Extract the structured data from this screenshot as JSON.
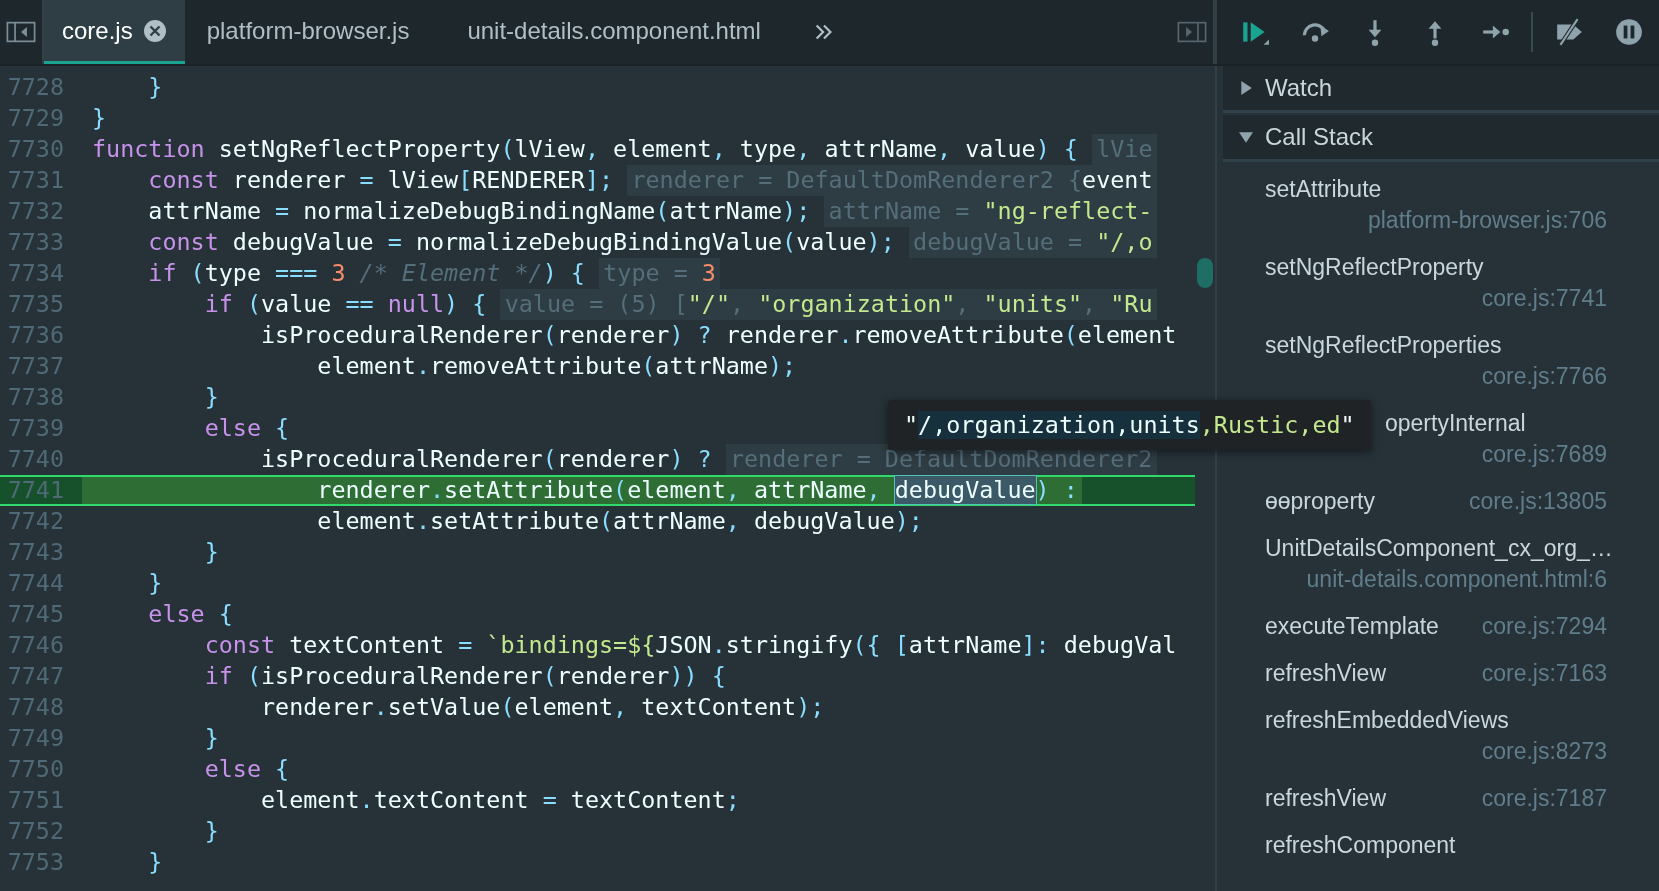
{
  "editor_tabs": [
    {
      "label": "core.js",
      "selected": true,
      "closable": true
    },
    {
      "label": "platform-browser.js",
      "selected": false,
      "closable": false
    },
    {
      "label": "unit-details.component.html",
      "selected": false,
      "closable": false
    }
  ],
  "debug_toolbar": [
    {
      "kind": "resume"
    },
    {
      "kind": "step_over"
    },
    {
      "kind": "step_into"
    },
    {
      "kind": "step_out"
    },
    {
      "kind": "step"
    },
    {
      "kind": "divider"
    },
    {
      "kind": "deactivate_breakpoints"
    },
    {
      "kind": "pause_exceptions"
    }
  ],
  "code": {
    "lines": [
      {
        "number": "7728",
        "current": false,
        "tokens": [
          {
            "kind": "punct",
            "text": "    }"
          }
        ]
      },
      {
        "number": "7729",
        "current": false,
        "tokens": [
          {
            "kind": "punct",
            "text": "}"
          }
        ]
      },
      {
        "number": "7730",
        "current": false,
        "tokens": [
          {
            "kind": "keyword",
            "text": "function"
          },
          {
            "kind": "plain",
            "text": " setNgReflectProperty"
          },
          {
            "kind": "punct",
            "text": "("
          },
          {
            "kind": "plain",
            "text": "lView"
          },
          {
            "kind": "punct",
            "text": ","
          },
          {
            "kind": "plain",
            "text": " element"
          },
          {
            "kind": "punct",
            "text": ","
          },
          {
            "kind": "plain",
            "text": " type"
          },
          {
            "kind": "punct",
            "text": ","
          },
          {
            "kind": "plain",
            "text": " attrName"
          },
          {
            "kind": "punct",
            "text": ","
          },
          {
            "kind": "plain",
            "text": " value"
          },
          {
            "kind": "punct",
            "text": ") {"
          }
        ],
        "hint": [
          {
            "kind": "muted",
            "text": "lVie"
          }
        ]
      },
      {
        "number": "7731",
        "current": false,
        "tokens": [
          {
            "kind": "keyword",
            "text": "    const"
          },
          {
            "kind": "plain",
            "text": " renderer "
          },
          {
            "kind": "punct",
            "text": "="
          },
          {
            "kind": "plain",
            "text": " lView"
          },
          {
            "kind": "punct",
            "text": "["
          },
          {
            "kind": "plain",
            "text": "RENDERER"
          },
          {
            "kind": "punct",
            "text": "];"
          }
        ],
        "hint": [
          {
            "kind": "muted",
            "text": "renderer = DefaultDomRenderer2 {"
          },
          {
            "kind": "plain",
            "text": "event"
          }
        ]
      },
      {
        "number": "7732",
        "current": false,
        "tokens": [
          {
            "kind": "plain",
            "text": "    attrName "
          },
          {
            "kind": "punct",
            "text": "="
          },
          {
            "kind": "plain",
            "text": " normalizeDebugBindingName"
          },
          {
            "kind": "punct",
            "text": "("
          },
          {
            "kind": "plain",
            "text": "attrName"
          },
          {
            "kind": "punct",
            "text": ");"
          }
        ],
        "hint": [
          {
            "kind": "muted",
            "text": "attrName = "
          },
          {
            "kind": "string",
            "text": "\"ng-reflect-"
          }
        ]
      },
      {
        "number": "7733",
        "current": false,
        "tokens": [
          {
            "kind": "keyword",
            "text": "    const"
          },
          {
            "kind": "plain",
            "text": " debugValue "
          },
          {
            "kind": "punct",
            "text": "="
          },
          {
            "kind": "plain",
            "text": " normalizeDebugBindingValue"
          },
          {
            "kind": "punct",
            "text": "("
          },
          {
            "kind": "plain",
            "text": "value"
          },
          {
            "kind": "punct",
            "text": ");"
          }
        ],
        "hint": [
          {
            "kind": "muted",
            "text": "debugValue = "
          },
          {
            "kind": "string",
            "text": "\"/,o"
          }
        ]
      },
      {
        "number": "7734",
        "current": false,
        "tokens": [
          {
            "kind": "keyword",
            "text": "    if"
          },
          {
            "kind": "punct",
            "text": " ("
          },
          {
            "kind": "plain",
            "text": "type "
          },
          {
            "kind": "punct",
            "text": "==="
          },
          {
            "kind": "number",
            "text": " 3"
          },
          {
            "kind": "comment",
            "text": " /* Element */"
          },
          {
            "kind": "punct",
            "text": ") {"
          }
        ],
        "hint": [
          {
            "kind": "muted",
            "text": "type = "
          },
          {
            "kind": "number",
            "text": "3"
          }
        ]
      },
      {
        "number": "7735",
        "current": false,
        "tokens": [
          {
            "kind": "keyword",
            "text": "        if"
          },
          {
            "kind": "punct",
            "text": " ("
          },
          {
            "kind": "plain",
            "text": "value "
          },
          {
            "kind": "punct",
            "text": "=="
          },
          {
            "kind": "keyword",
            "text": " null"
          },
          {
            "kind": "punct",
            "text": ") {"
          }
        ],
        "hint": [
          {
            "kind": "muted",
            "text": "value = (5) ["
          },
          {
            "kind": "string",
            "text": "\"/\""
          },
          {
            "kind": "muted",
            "text": ", "
          },
          {
            "kind": "string",
            "text": "\"organization\""
          },
          {
            "kind": "muted",
            "text": ", "
          },
          {
            "kind": "string",
            "text": "\"units\""
          },
          {
            "kind": "muted",
            "text": ", "
          },
          {
            "kind": "string",
            "text": "\"Ru"
          }
        ]
      },
      {
        "number": "7736",
        "current": false,
        "tokens": [
          {
            "kind": "plain",
            "text": "            isProceduralRenderer"
          },
          {
            "kind": "punct",
            "text": "("
          },
          {
            "kind": "plain",
            "text": "renderer"
          },
          {
            "kind": "punct",
            "text": ") ?"
          },
          {
            "kind": "plain",
            "text": " renderer"
          },
          {
            "kind": "punct",
            "text": "."
          },
          {
            "kind": "plain",
            "text": "removeAttribute"
          },
          {
            "kind": "punct",
            "text": "("
          },
          {
            "kind": "plain",
            "text": "element"
          }
        ]
      },
      {
        "number": "7737",
        "current": false,
        "tokens": [
          {
            "kind": "plain",
            "text": "                element"
          },
          {
            "kind": "punct",
            "text": "."
          },
          {
            "kind": "plain",
            "text": "removeAttribute"
          },
          {
            "kind": "punct",
            "text": "("
          },
          {
            "kind": "plain",
            "text": "attrName"
          },
          {
            "kind": "punct",
            "text": ");"
          }
        ]
      },
      {
        "number": "7738",
        "current": false,
        "tokens": [
          {
            "kind": "punct",
            "text": "        }"
          }
        ]
      },
      {
        "number": "7739",
        "current": false,
        "tokens": [
          {
            "kind": "keyword",
            "text": "        else"
          },
          {
            "kind": "punct",
            "text": " {"
          }
        ]
      },
      {
        "number": "7740",
        "current": false,
        "tokens": [
          {
            "kind": "plain",
            "text": "            isProceduralRenderer"
          },
          {
            "kind": "punct",
            "text": "("
          },
          {
            "kind": "plain",
            "text": "renderer"
          },
          {
            "kind": "punct",
            "text": ") ?"
          }
        ],
        "hint": [
          {
            "kind": "muted",
            "text": "renderer = DefaultDomRenderer2"
          }
        ]
      },
      {
        "number": "7741",
        "current": true,
        "tokens": [
          {
            "kind": "plain",
            "text": "                renderer"
          },
          {
            "kind": "punct",
            "text": "."
          },
          {
            "kind": "plain",
            "text": "setAttribute"
          },
          {
            "kind": "punct",
            "text": "("
          },
          {
            "kind": "plain",
            "text": "element"
          },
          {
            "kind": "punct",
            "text": ","
          },
          {
            "kind": "plain",
            "text": " attrName"
          },
          {
            "kind": "punct",
            "text": ", "
          },
          {
            "kind": "hovered",
            "text": "debugValue"
          },
          {
            "kind": "punct",
            "text": ") :"
          }
        ]
      },
      {
        "number": "7742",
        "current": false,
        "tokens": [
          {
            "kind": "plain",
            "text": "                element"
          },
          {
            "kind": "punct",
            "text": "."
          },
          {
            "kind": "plain",
            "text": "setAttribute"
          },
          {
            "kind": "punct",
            "text": "("
          },
          {
            "kind": "plain",
            "text": "attrName"
          },
          {
            "kind": "punct",
            "text": ","
          },
          {
            "kind": "plain",
            "text": " debugValue"
          },
          {
            "kind": "punct",
            "text": ");"
          }
        ]
      },
      {
        "number": "7743",
        "current": false,
        "tokens": [
          {
            "kind": "punct",
            "text": "        }"
          }
        ]
      },
      {
        "number": "7744",
        "current": false,
        "tokens": [
          {
            "kind": "punct",
            "text": "    }"
          }
        ]
      },
      {
        "number": "7745",
        "current": false,
        "tokens": [
          {
            "kind": "keyword",
            "text": "    else"
          },
          {
            "kind": "punct",
            "text": " {"
          }
        ]
      },
      {
        "number": "7746",
        "current": false,
        "tokens": [
          {
            "kind": "keyword",
            "text": "        const"
          },
          {
            "kind": "plain",
            "text": " textContent "
          },
          {
            "kind": "punct",
            "text": "="
          },
          {
            "kind": "string",
            "text": " `bindings=${"
          },
          {
            "kind": "plain",
            "text": "JSON"
          },
          {
            "kind": "punct",
            "text": "."
          },
          {
            "kind": "plain",
            "text": "stringify"
          },
          {
            "kind": "punct",
            "text": "({ ["
          },
          {
            "kind": "plain",
            "text": "attrName"
          },
          {
            "kind": "punct",
            "text": "]:"
          },
          {
            "kind": "plain",
            "text": " debugVal"
          }
        ]
      },
      {
        "number": "7747",
        "current": false,
        "tokens": [
          {
            "kind": "keyword",
            "text": "        if"
          },
          {
            "kind": "punct",
            "text": " ("
          },
          {
            "kind": "plain",
            "text": "isProceduralRenderer"
          },
          {
            "kind": "punct",
            "text": "("
          },
          {
            "kind": "plain",
            "text": "renderer"
          },
          {
            "kind": "punct",
            "text": ")) {"
          }
        ]
      },
      {
        "number": "7748",
        "current": false,
        "tokens": [
          {
            "kind": "plain",
            "text": "            renderer"
          },
          {
            "kind": "punct",
            "text": "."
          },
          {
            "kind": "plain",
            "text": "setValue"
          },
          {
            "kind": "punct",
            "text": "("
          },
          {
            "kind": "plain",
            "text": "element"
          },
          {
            "kind": "punct",
            "text": ","
          },
          {
            "kind": "plain",
            "text": " textContent"
          },
          {
            "kind": "punct",
            "text": ");"
          }
        ]
      },
      {
        "number": "7749",
        "current": false,
        "tokens": [
          {
            "kind": "punct",
            "text": "        }"
          }
        ]
      },
      {
        "number": "7750",
        "current": false,
        "tokens": [
          {
            "kind": "keyword",
            "text": "        else"
          },
          {
            "kind": "punct",
            "text": " {"
          }
        ]
      },
      {
        "number": "7751",
        "current": false,
        "tokens": [
          {
            "kind": "plain",
            "text": "            element"
          },
          {
            "kind": "punct",
            "text": "."
          },
          {
            "kind": "plain",
            "text": "textContent "
          },
          {
            "kind": "punct",
            "text": "="
          },
          {
            "kind": "plain",
            "text": " textContent"
          },
          {
            "kind": "punct",
            "text": ";"
          }
        ]
      },
      {
        "number": "7752",
        "current": false,
        "tokens": [
          {
            "kind": "punct",
            "text": "        }"
          }
        ]
      },
      {
        "number": "7753",
        "current": false,
        "tokens": [
          {
            "kind": "punct",
            "text": "    }"
          }
        ]
      }
    ]
  },
  "value_tooltip": {
    "parts": [
      {
        "kind": "quote",
        "text": "\""
      },
      {
        "kind": "selection",
        "text": "/,organization,units"
      },
      {
        "kind": "string",
        "text": ",Rustic,ed"
      },
      {
        "kind": "quote",
        "text": "\""
      }
    ]
  },
  "sidebar": {
    "sections": [
      {
        "title": "Watch",
        "expanded": false
      },
      {
        "title": "Call Stack",
        "expanded": true
      }
    ],
    "call_stack": [
      {
        "function": "setAttribute",
        "location": "platform-browser.js:706",
        "covered": false
      },
      {
        "function": "setNgReflectProperty",
        "location": "core.js:7741",
        "covered": false
      },
      {
        "function": "setNgReflectProperties",
        "location": "core.js:7766",
        "covered": false
      },
      {
        "function": "opertyInternal",
        "location": "core.js:7689",
        "covered": true
      },
      {
        "function": "ɵɵproperty",
        "location": "core.js:13805",
        "covered": false
      },
      {
        "function": "UnitDetailsComponent_cx_org_…",
        "location": "unit-details.component.html:6",
        "covered": false
      },
      {
        "function": "executeTemplate",
        "location": "core.js:7294",
        "covered": false
      },
      {
        "function": "refreshView",
        "location": "core.js:7163",
        "covered": false
      },
      {
        "function": "refreshEmbeddedViews",
        "location": "core.js:8273",
        "covered": false
      },
      {
        "function": "refreshView",
        "location": "core.js:7187",
        "covered": false
      },
      {
        "function": "refreshComponent",
        "covered": false
      }
    ]
  }
}
